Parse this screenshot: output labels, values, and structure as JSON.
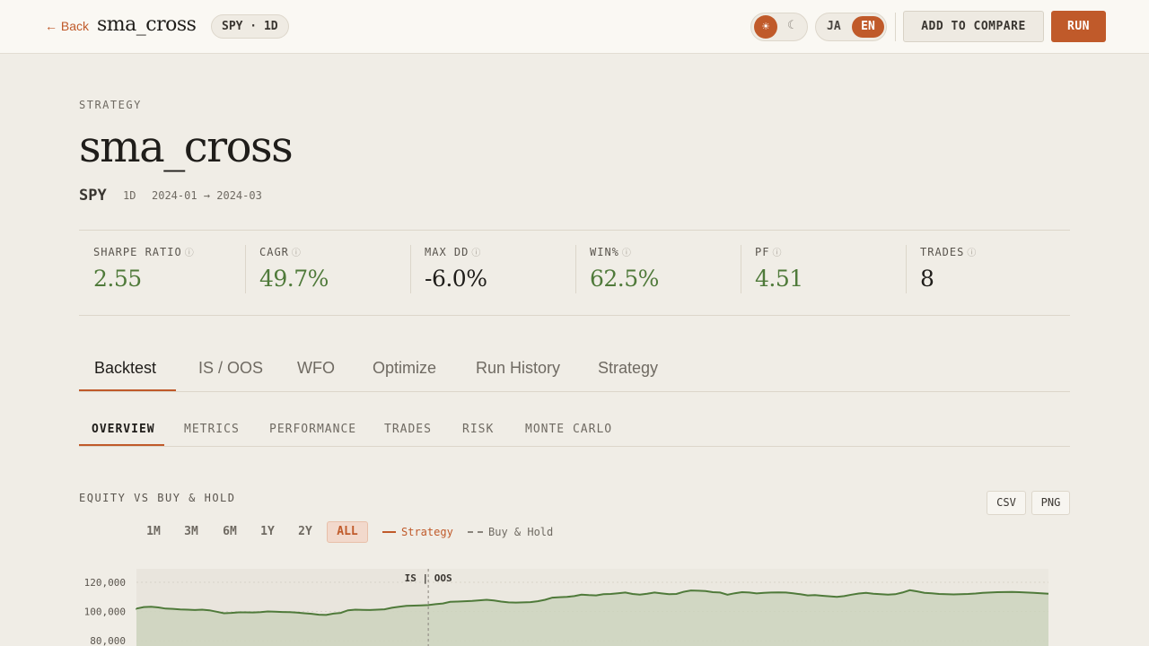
{
  "topbar": {
    "back_label": "← Back",
    "title": "sma_cross",
    "pill": "SPY · 1D",
    "theme_light_icon": "☀",
    "theme_dark_icon": "☾",
    "lang_ja": "JA",
    "lang_en": "EN",
    "compare_label": "ADD TO COMPARE",
    "run_label": "RUN"
  },
  "header": {
    "eyebrow": "STRATEGY",
    "title": "sma_cross",
    "symbol": "SPY",
    "timeframe": "1D",
    "range": "2024-01 → 2024-03"
  },
  "metrics": [
    {
      "label": "SHARPE RATIO",
      "value": "2.55",
      "tone": "positive"
    },
    {
      "label": "CAGR",
      "value": "49.7%",
      "tone": "positive"
    },
    {
      "label": "MAX DD",
      "value": "-6.0%",
      "tone": "neutral"
    },
    {
      "label": "WIN%",
      "value": "62.5%",
      "tone": "positive"
    },
    {
      "label": "PF",
      "value": "4.51",
      "tone": "positive"
    },
    {
      "label": "TRADES",
      "value": "8",
      "tone": "neutral"
    }
  ],
  "info_icon": "ⓘ",
  "tabs": [
    "Backtest",
    "IS / OOS",
    "WFO",
    "Optimize",
    "Run History",
    "Strategy"
  ],
  "active_tab": "Backtest",
  "subtabs": [
    "OVERVIEW",
    "METRICS",
    "PERFORMANCE",
    "TRADES",
    "RISK",
    "MONTE CARLO"
  ],
  "active_subtab": "OVERVIEW",
  "chart": {
    "title": "EQUITY VS BUY & HOLD",
    "export_csv": "CSV",
    "export_png": "PNG",
    "ranges": [
      "1M",
      "3M",
      "6M",
      "1Y",
      "2Y",
      "ALL"
    ],
    "active_range": "ALL",
    "legend_strategy": "Strategy",
    "legend_bh": "Buy & Hold",
    "split_label": "IS | OOS"
  },
  "colors": {
    "accent": "#c05a2a",
    "positive": "#4f7a3a",
    "neutral": "#1f1d1a"
  },
  "chart_data": {
    "type": "area",
    "ylabel": "",
    "yticks": [
      120000,
      100000,
      80000
    ],
    "ytick_labels": [
      "120,000",
      "100,000",
      "80,000"
    ],
    "ylim": [
      60000,
      130000
    ],
    "split_index": 40,
    "series": [
      {
        "name": "Strategy",
        "values": [
          102000,
          103000,
          103200,
          102800,
          102000,
          101800,
          101400,
          101200,
          101000,
          101200,
          100800,
          99800,
          98800,
          99000,
          99400,
          99400,
          99300,
          99500,
          100000,
          99800,
          99600,
          99500,
          99200,
          98800,
          98400,
          97800,
          97600,
          98500,
          99000,
          100800,
          101200,
          101100,
          101000,
          101200,
          101500,
          102500,
          103200,
          103800,
          104000,
          104200,
          104400,
          105000,
          105500,
          106600,
          106800,
          107000,
          107200,
          107600,
          108000,
          107500,
          106800,
          106200,
          106100,
          106200,
          106400,
          107000,
          108000,
          109500,
          109800,
          110000,
          110500,
          111500,
          111200,
          111000,
          111800,
          112000,
          112500,
          113000,
          112000,
          111500,
          112200,
          113000,
          112400,
          111800,
          112000,
          113500,
          114400,
          114200,
          114000,
          113200,
          113000,
          111500,
          112500,
          113200,
          113000,
          112400,
          112800,
          113000,
          113100,
          113000,
          112500,
          111800,
          111000,
          111200,
          110800,
          110400,
          110000,
          110500,
          111500,
          112300,
          112800,
          112200,
          111800,
          111500,
          111800,
          113000,
          114600,
          113800,
          112800,
          112500,
          112000,
          111800,
          111700,
          111800,
          112000,
          112300,
          112800,
          113000,
          113200,
          113300,
          113400,
          113200,
          113000,
          112800,
          112500,
          112100
        ]
      }
    ]
  }
}
